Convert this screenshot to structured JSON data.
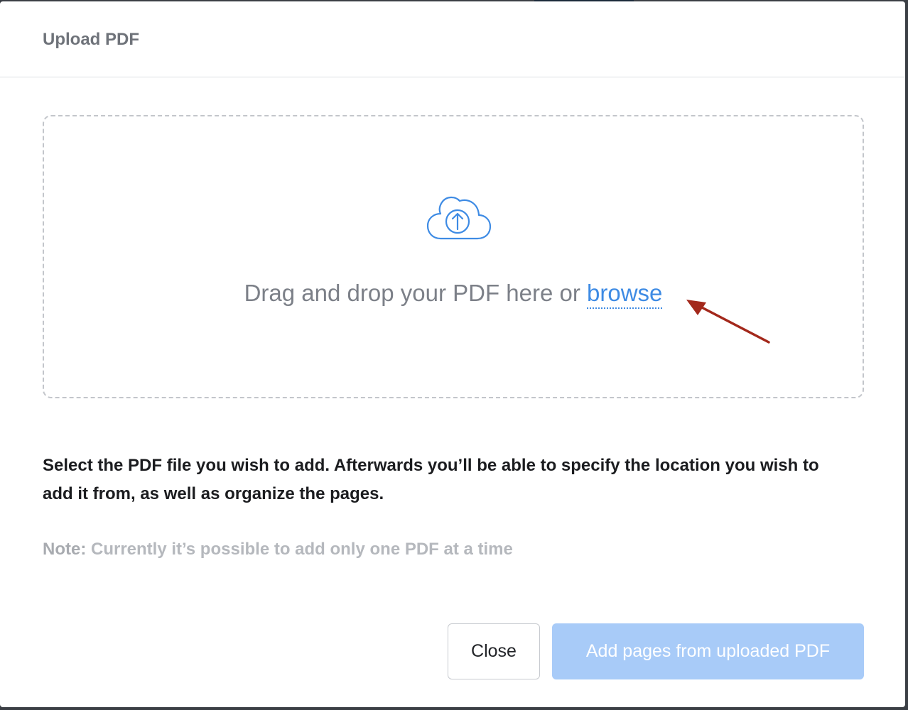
{
  "dialog": {
    "title": "Upload PDF"
  },
  "dropzone": {
    "prompt": "Drag and drop your PDF here or ",
    "browse_label": "browse",
    "icon": "cloud-upload-icon",
    "accent_color": "#3e8be4"
  },
  "annotation": {
    "icon": "red-arrow-icon",
    "color": "#a3281b"
  },
  "description": "Select the PDF file you wish to add. Afterwards you’ll be able to specify the location you wish to add it from, as well as organize the pages.",
  "note": {
    "label": "Note:",
    "text": " Currently it’s possible to add only one PDF at a time"
  },
  "footer": {
    "close_label": "Close",
    "add_label": "Add pages from uploaded PDF",
    "add_disabled": true
  }
}
